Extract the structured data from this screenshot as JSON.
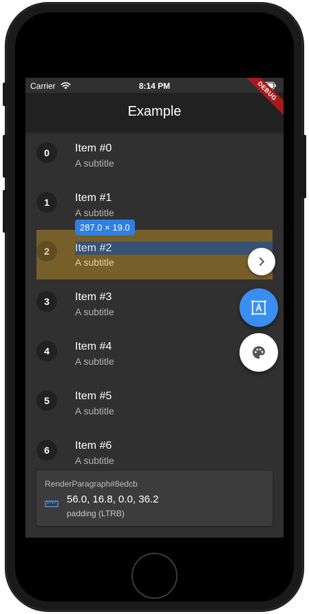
{
  "status_bar": {
    "carrier": "Carrier",
    "time": "8:14 PM"
  },
  "app_bar": {
    "title": "Example"
  },
  "debug_banner": "DEBUG",
  "items": [
    {
      "index": "0",
      "title": "Item #0",
      "subtitle": "A subtitle"
    },
    {
      "index": "1",
      "title": "Item #1",
      "subtitle": "A subtitle"
    },
    {
      "index": "2",
      "title": "Item #2",
      "subtitle": "A subtitle"
    },
    {
      "index": "3",
      "title": "Item #3",
      "subtitle": "A subtitle"
    },
    {
      "index": "4",
      "title": "Item #4",
      "subtitle": "A subtitle"
    },
    {
      "index": "5",
      "title": "Item #5",
      "subtitle": "A subtitle"
    },
    {
      "index": "6",
      "title": "Item #6",
      "subtitle": "A subtitle"
    }
  ],
  "inspector": {
    "size_tooltip": "287.0 × 19.0",
    "selected_item_index": 2,
    "panel_title": "RenderParagraph#8edcb",
    "padding_value": "56.0, 16.8, 0.0, 36.2",
    "padding_label": "padding (LTRB)"
  },
  "icons": {
    "wifi": "wifi-icon",
    "battery": "battery-icon",
    "chevron": "chevron-right-icon",
    "select_mode": "select-widget-icon",
    "palette": "palette-icon",
    "ruler": "ruler-icon"
  },
  "colors": {
    "background": "#303030",
    "app_bar": "#212121",
    "highlight": "#806528",
    "accent": "#3a8ef0",
    "debug": "#a51c1c"
  }
}
